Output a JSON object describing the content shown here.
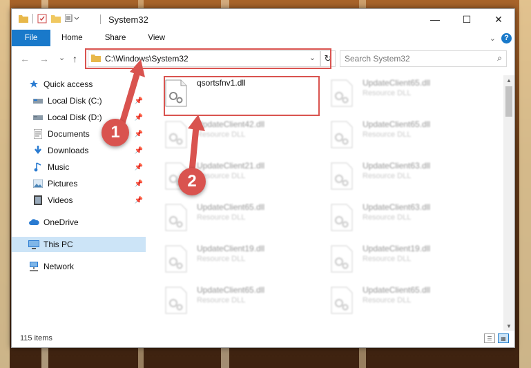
{
  "window": {
    "title": "System32",
    "min_glyph": "—",
    "max_glyph": "☐",
    "close_glyph": "✕"
  },
  "ribbon": {
    "tabs": [
      "File",
      "Home",
      "Share",
      "View"
    ]
  },
  "address_bar": {
    "path": "C:\\Windows\\System32",
    "dropdown_glyph": "⌄",
    "refresh_glyph": "↻"
  },
  "search": {
    "placeholder": "Search System32",
    "icon_glyph": "⌕"
  },
  "nav_buttons": {
    "back": "←",
    "forward": "→",
    "recent": "⌄",
    "up": "↑"
  },
  "nav_pane": {
    "items": [
      {
        "label": "Quick access",
        "icon": "star-icon"
      },
      {
        "label": "Local Disk (C:)",
        "icon": "drive-icon",
        "pinned": true
      },
      {
        "label": "Local Disk (D:)",
        "icon": "drive-icon",
        "pinned": true
      },
      {
        "label": "Documents",
        "icon": "documents-icon",
        "pinned": true
      },
      {
        "label": "Downloads",
        "icon": "download-icon",
        "pinned": true
      },
      {
        "label": "Music",
        "icon": "music-icon",
        "pinned": true
      },
      {
        "label": "Pictures",
        "icon": "pictures-icon",
        "pinned": true
      },
      {
        "label": "Videos",
        "icon": "videos-icon",
        "pinned": true
      },
      {
        "label": "OneDrive",
        "icon": "cloud-icon"
      },
      {
        "label": "This PC",
        "icon": "computer-icon",
        "selected": true
      },
      {
        "label": "Network",
        "icon": "network-icon"
      }
    ]
  },
  "files": [
    {
      "name": "qsortsfnv1.dll",
      "type": ""
    },
    {
      "name": "UpdateClient65.dll",
      "type": "Resource DLL"
    },
    {
      "name": "UpdateClient42.dll",
      "type": "Resource DLL"
    },
    {
      "name": "UpdateClient65.dll",
      "type": "Resource DLL"
    },
    {
      "name": "UpdateClient21.dll",
      "type": "Resource DLL"
    },
    {
      "name": "UpdateClient63.dll",
      "type": "Resource DLL"
    },
    {
      "name": "UpdateClient65.dll",
      "type": "Resource DLL"
    },
    {
      "name": "UpdateClient63.dll",
      "type": "Resource DLL"
    },
    {
      "name": "UpdateClient19.dll",
      "type": "Resource DLL"
    },
    {
      "name": "UpdateClient19.dll",
      "type": "Resource DLL"
    },
    {
      "name": "UpdateClient65.dll",
      "type": "Resource DLL"
    },
    {
      "name": "UpdateClient65.dll",
      "type": "Resource DLL"
    }
  ],
  "status": {
    "item_count": "115 items"
  },
  "annotations": {
    "step1": "1",
    "step2": "2",
    "color": "#d9534f"
  },
  "colors": {
    "accent": "#1979ca",
    "selection": "#cce4f7"
  }
}
